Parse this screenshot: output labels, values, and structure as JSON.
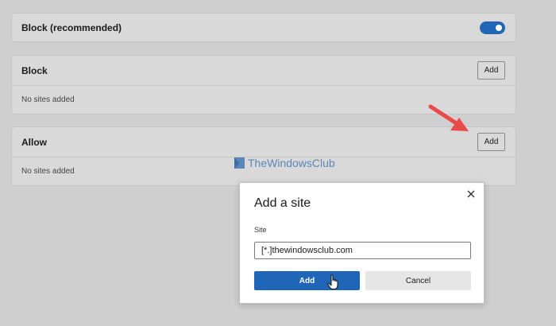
{
  "block_recommended": {
    "label": "Block (recommended)",
    "toggle_on": true
  },
  "block_section": {
    "title": "Block",
    "add_label": "Add",
    "empty_text": "No sites added"
  },
  "allow_section": {
    "title": "Allow",
    "add_label": "Add",
    "empty_text": "No sites added"
  },
  "watermark": {
    "text": "TheWindowsClub"
  },
  "dialog": {
    "title": "Add a site",
    "field_label": "Site",
    "field_value": "[*.]thewindowsclub.com",
    "add_label": "Add",
    "cancel_label": "Cancel"
  },
  "colors": {
    "accent": "#1f66b8",
    "arrow": "#e84a4a",
    "watermark": "#5a87b8"
  }
}
